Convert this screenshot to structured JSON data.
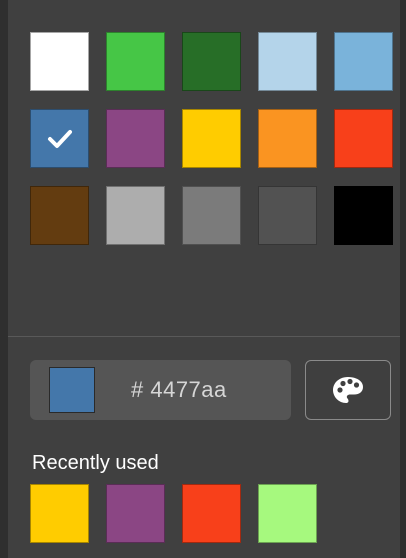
{
  "palette": {
    "swatches": [
      {
        "color": "#ffffff",
        "name": "white"
      },
      {
        "color": "#46c646",
        "name": "green"
      },
      {
        "color": "#276e27",
        "name": "dark-green"
      },
      {
        "color": "#b4d4ea",
        "name": "light-blue"
      },
      {
        "color": "#7ab3da",
        "name": "sky-blue"
      },
      {
        "color": "#4477aa",
        "name": "blue",
        "selected": true
      },
      {
        "color": "#8b4684",
        "name": "purple"
      },
      {
        "color": "#ffcc00",
        "name": "yellow"
      },
      {
        "color": "#fa9421",
        "name": "orange"
      },
      {
        "color": "#f8401a",
        "name": "red"
      },
      {
        "color": "#633c10",
        "name": "brown"
      },
      {
        "color": "#adadad",
        "name": "light-gray"
      },
      {
        "color": "#7b7b7b",
        "name": "gray"
      },
      {
        "color": "#525252",
        "name": "dark-gray"
      },
      {
        "color": "#000000",
        "name": "black"
      }
    ],
    "selected_icon": "check-icon"
  },
  "hex_input": {
    "color": "#4477aa",
    "value": "# 4477aa"
  },
  "palette_button": {
    "icon": "palette-icon"
  },
  "recently_used": {
    "label": "Recently used",
    "colors": [
      "#ffcc00",
      "#8b4684",
      "#f8401a",
      "#a6f97e"
    ]
  }
}
